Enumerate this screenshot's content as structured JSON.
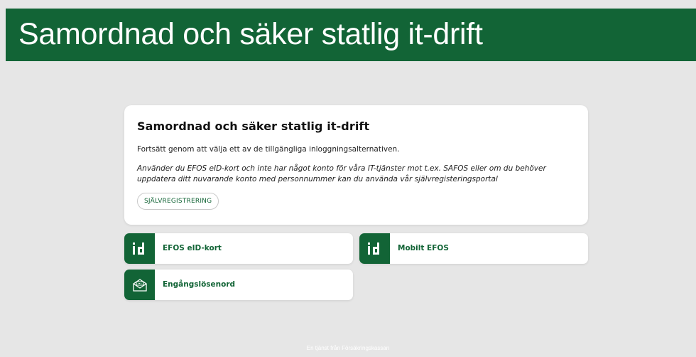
{
  "header": {
    "title": "Samordnad och säker statlig it-drift"
  },
  "card": {
    "title": "Samordnad och säker statlig it-drift",
    "intro": "Fortsätt genom att välja ett av de tillgängliga inloggningsalternativen.",
    "note": "Använder du EFOS eID-kort och inte har något konto för våra IT-tjänster mot t.ex. SAFOS eller om du behöver uppdatera ditt nuvarande konto med personnummer kan du använda vår självregisteringsportal",
    "register_button": "SJÄLVREGISTRERING"
  },
  "options": [
    {
      "label": "EFOS eID-kort",
      "icon": "id-icon"
    },
    {
      "label": "Mobilt EFOS",
      "icon": "id-icon"
    },
    {
      "label": "Engångslösenord",
      "icon": "envelope-icon"
    }
  ],
  "footer": {
    "text": "En tjänst från Försäkringskassan"
  },
  "colors": {
    "brand": "#126436",
    "background": "#e6e6e6"
  }
}
